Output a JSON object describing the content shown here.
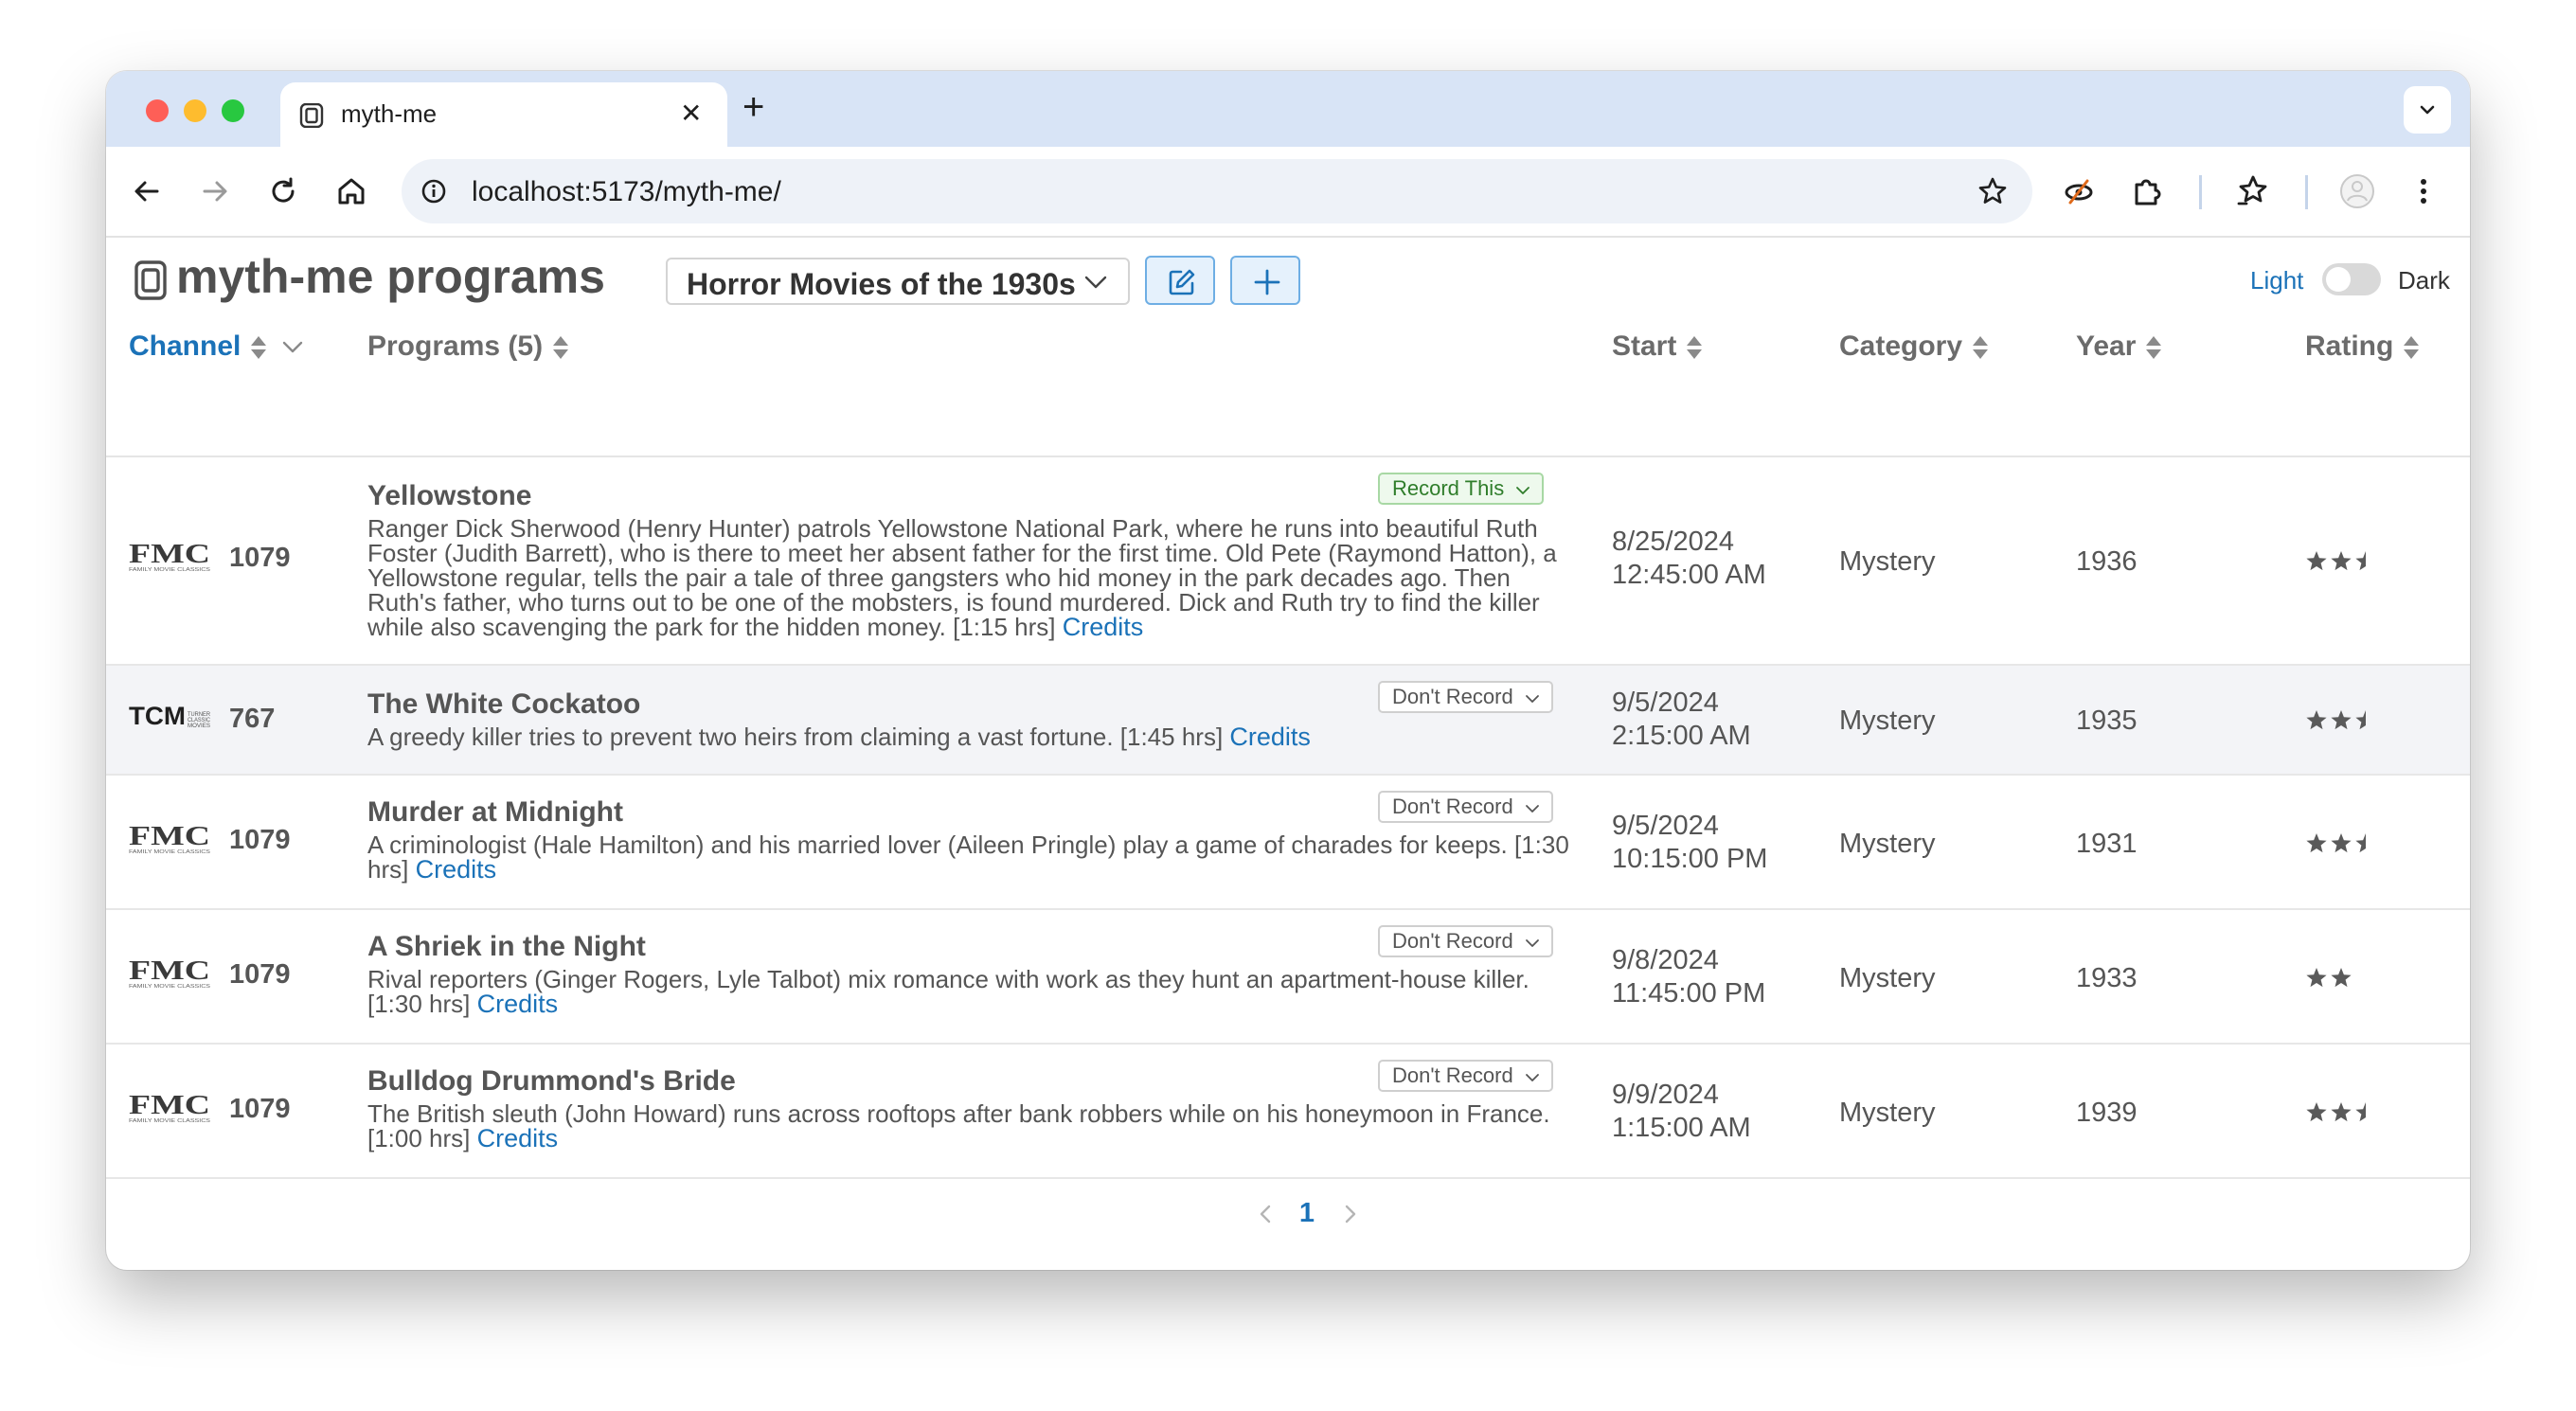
{
  "browser": {
    "tab_title": "myth-me",
    "url": "localhost:5173/myth-me/"
  },
  "app": {
    "brand": "myth-me",
    "section": "programs",
    "selected_list": "Horror Movies of the 1930s",
    "theme_light_label": "Light",
    "theme_dark_label": "Dark",
    "theme": "light"
  },
  "table": {
    "headers": {
      "channel": "Channel",
      "programs": "Programs (5)",
      "start": "Start",
      "category": "Category",
      "year": "Year",
      "rating": "Rating"
    },
    "rows": [
      {
        "logo": "FMC",
        "logo_sub": "FAMILY MOVIE CLASSICS",
        "channel": "1079",
        "title": "Yellowstone",
        "record": "Record This",
        "desc": "Ranger Dick Sherwood (Henry Hunter) patrols Yellowstone National Park, where he runs into beautiful Ruth Foster (Judith Barrett), who is there to meet her absent father for the first time. Old Pete (Raymond Hatton), a Yellowstone regular, tells the pair a tale of three gangsters who hid money in the park decades ago. Then Ruth's father, who turns out to be one of the mobsters, is found murdered. Dick and Ruth try to find the killer while also scavenging the park for the hidden money. [1:15 hrs]",
        "credits": "Credits",
        "start_date": "8/25/2024",
        "start_time": "12:45:00 AM",
        "category": "Mystery",
        "year": "1936",
        "rating": 2.5
      },
      {
        "logo": "TCM",
        "logo_sub": "TURNER CLASSIC MOVIES",
        "channel": "767",
        "title": "The White Cockatoo",
        "record": "Don't Record",
        "desc": "A greedy killer tries to prevent two heirs from claiming a vast fortune. [1:45 hrs]",
        "credits": "Credits",
        "start_date": "9/5/2024",
        "start_time": "2:15:00 AM",
        "category": "Mystery",
        "year": "1935",
        "rating": 2.5
      },
      {
        "logo": "FMC",
        "logo_sub": "FAMILY MOVIE CLASSICS",
        "channel": "1079",
        "title": "Murder at Midnight",
        "record": "Don't Record",
        "desc": "A criminologist (Hale Hamilton) and his married lover (Aileen Pringle) play a game of charades for keeps.  [1:30 hrs]",
        "credits": "Credits",
        "start_date": "9/5/2024",
        "start_time": "10:15:00 PM",
        "category": "Mystery",
        "year": "1931",
        "rating": 2.5
      },
      {
        "logo": "FMC",
        "logo_sub": "FAMILY MOVIE CLASSICS",
        "channel": "1079",
        "title": "A Shriek in the Night",
        "record": "Don't Record",
        "desc": "Rival reporters (Ginger Rogers, Lyle Talbot) mix romance with work as they hunt an apartment-house killer.  [1:30 hrs]",
        "credits": "Credits",
        "start_date": "9/8/2024",
        "start_time": "11:45:00 PM",
        "category": "Mystery",
        "year": "1933",
        "rating": 2
      },
      {
        "logo": "FMC",
        "logo_sub": "FAMILY MOVIE CLASSICS",
        "channel": "1079",
        "title": "Bulldog Drummond's Bride",
        "record": "Don't Record",
        "desc": "The British sleuth (John Howard) runs across rooftops after bank robbers while on his honeymoon in France.  [1:00 hrs]",
        "credits": "Credits",
        "start_date": "9/9/2024",
        "start_time": "1:15:00 AM",
        "category": "Mystery",
        "year": "1939",
        "rating": 2.5
      }
    ]
  },
  "pagination": {
    "current_page": "1"
  },
  "colors": {
    "accent": "#1b72b8",
    "record_this": "#2f7d2a",
    "text": "#555555",
    "tab_strip": "#d8e4f6"
  }
}
